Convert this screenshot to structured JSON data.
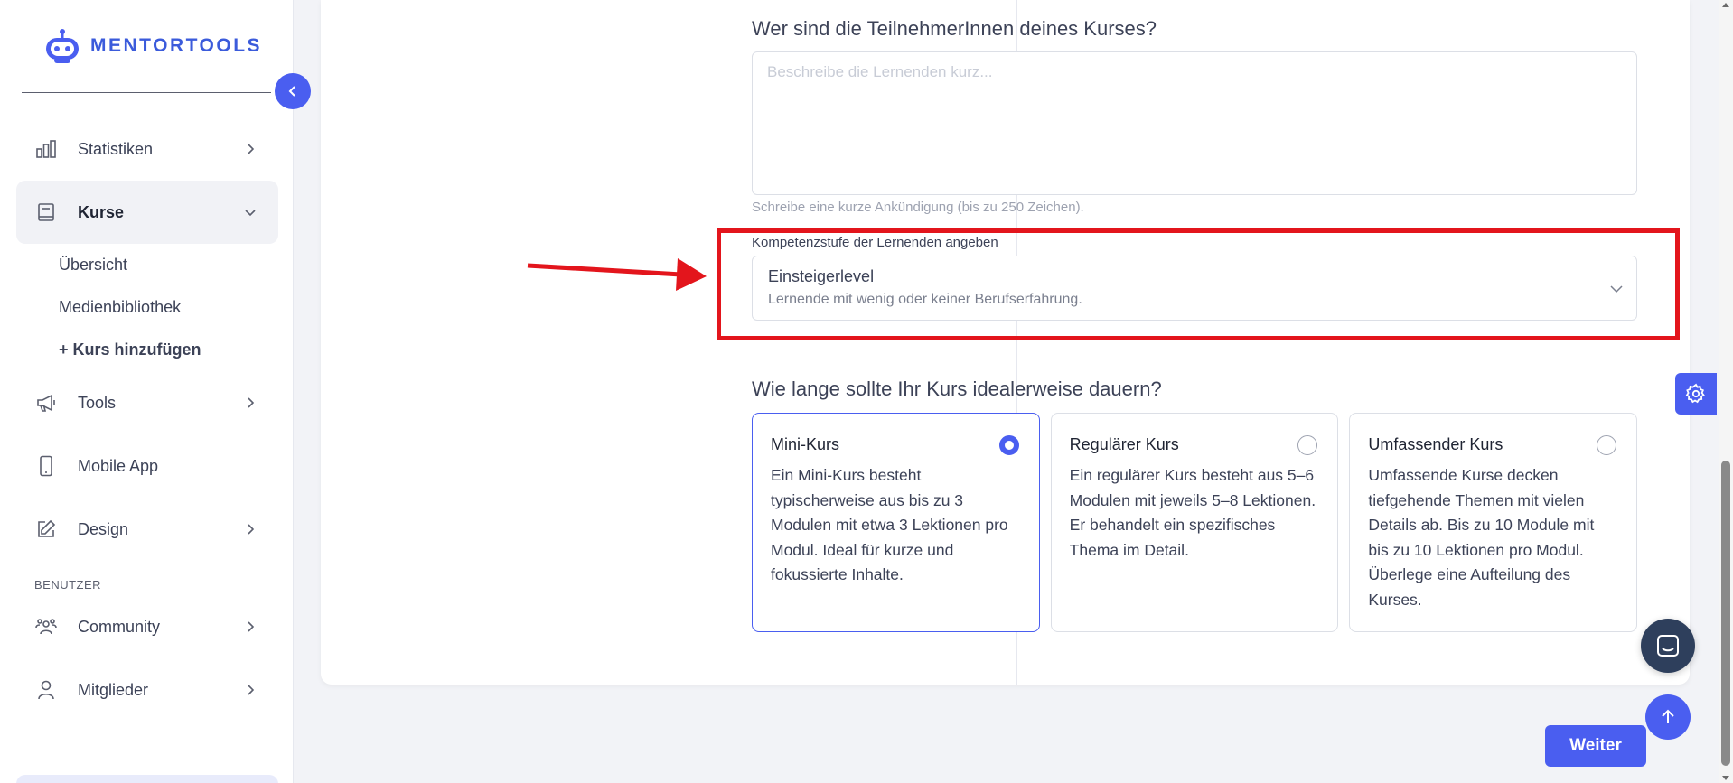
{
  "brand": {
    "name": "MENTORTOOLS",
    "accent": "#4a5ef0",
    "highlight": "#e3151c"
  },
  "sidebar": {
    "items": [
      {
        "label": "Statistiken",
        "icon": "bar-chart-icon"
      },
      {
        "label": "Kurse",
        "icon": "book-icon",
        "expanded": true
      },
      {
        "label": "Tools",
        "icon": "megaphone-icon"
      },
      {
        "label": "Mobile App",
        "icon": "smartphone-icon"
      },
      {
        "label": "Design",
        "icon": "edit-icon"
      }
    ],
    "sub_items": [
      {
        "label": "Übersicht"
      },
      {
        "label": "Medienbibliothek"
      },
      {
        "label": "+ Kurs hinzufügen"
      }
    ],
    "section_label": "BENUTZER",
    "user_items": [
      {
        "label": "Community",
        "icon": "community-icon"
      },
      {
        "label": "Mitglieder",
        "icon": "user-icon"
      }
    ]
  },
  "form": {
    "participants_question": "Wer sind die TeilnehmerInnen deines Kurses?",
    "participants_placeholder": "Beschreibe die Lernenden kurz...",
    "participants_hint": "Schreibe eine kurze Ankündigung (bis zu 250 Zeichen).",
    "level_label": "Kompetenzstufe der Lernenden angeben",
    "level_value": "Einsteigerlevel",
    "level_desc": "Lernende mit wenig oder keiner Berufserfahrung.",
    "duration_question": "Wie lange sollte Ihr Kurs idealerweise dauern?",
    "options": [
      {
        "title": "Mini-Kurs",
        "desc": "Ein Mini-Kurs besteht typischerweise aus bis zu 3 Modulen mit etwa 3 Lektionen pro Modul. Ideal für kurze und fokussierte Inhalte.",
        "selected": true
      },
      {
        "title": "Regulärer Kurs",
        "desc": "Ein regulärer Kurs besteht aus 5–6 Modulen mit jeweils 5–8 Lektionen. Er behandelt ein spezifisches Thema im Detail.",
        "selected": false
      },
      {
        "title": "Umfassender Kurs",
        "desc": "Umfassende Kurse decken tiefgehende Themen mit vielen Details ab. Bis zu 10 Module mit bis zu 10 Lektionen pro Modul. Überlege eine Aufteilung des Kurses.",
        "selected": false
      }
    ],
    "next_label": "Weiter"
  }
}
